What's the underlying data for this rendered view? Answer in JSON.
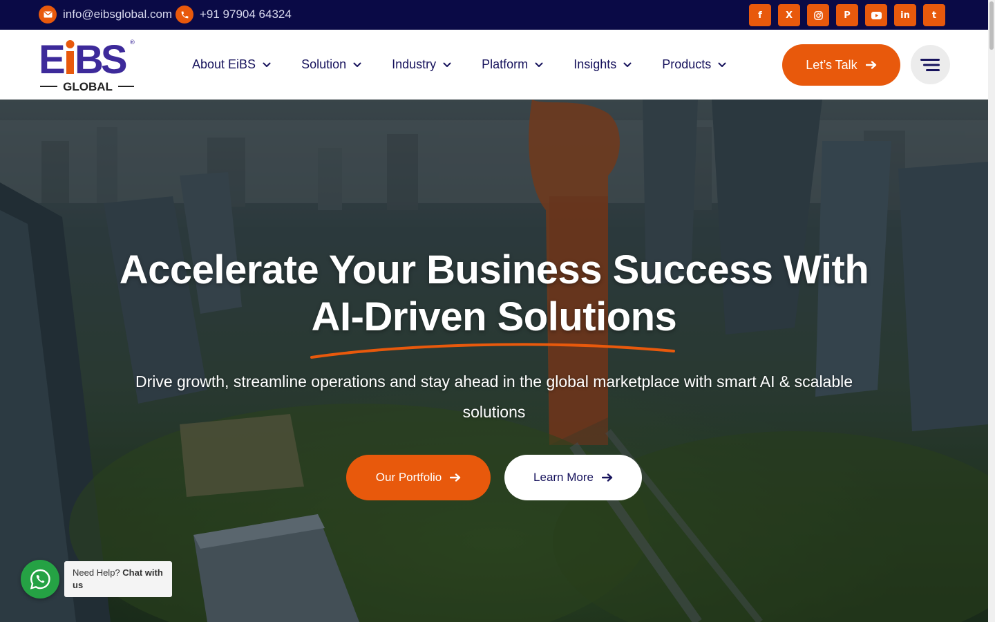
{
  "topbar": {
    "email": "info@eibsglobal.com",
    "phone": "+91 97904 64324",
    "socials": [
      {
        "icon": "facebook-icon",
        "glyph": "f"
      },
      {
        "icon": "x-twitter-icon",
        "glyph": "X"
      },
      {
        "icon": "instagram-icon",
        "glyph": ""
      },
      {
        "icon": "pinterest-icon",
        "glyph": "P"
      },
      {
        "icon": "youtube-icon",
        "glyph": ""
      },
      {
        "icon": "linkedin-icon",
        "glyph": "in"
      },
      {
        "icon": "tumblr-icon",
        "glyph": "t"
      }
    ]
  },
  "logo": {
    "main": "EiBS",
    "sub": "GLOBAL",
    "mark": "®"
  },
  "nav": {
    "items": [
      "About EiBS",
      "Solution",
      "Industry",
      "Platform",
      "Insights",
      "Products"
    ]
  },
  "cta": {
    "label": "Let’s Talk"
  },
  "hero": {
    "title_line1": "Accelerate Your Business Success With",
    "title_line2": "AI-Driven Solutions",
    "subtitle": "Drive growth, streamline operations and stay ahead in the global marketplace with smart AI & scalable solutions",
    "primary_button": "Our Portfolio",
    "secondary_button": "Learn More"
  },
  "chat": {
    "prefix": "Need Help?",
    "strong": "Chat with us"
  },
  "colors": {
    "brand_orange": "#e8590c",
    "navy": "#0a0a46",
    "nav_text": "#16125c",
    "whatsapp": "#25a244"
  }
}
